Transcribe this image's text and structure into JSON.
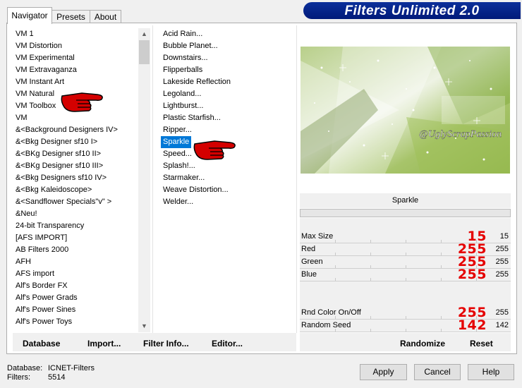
{
  "tabs": [
    "Navigator",
    "Presets",
    "About"
  ],
  "banner_title": "Filters Unlimited 2.0",
  "categories": [
    "VM 1",
    "VM Distortion",
    "VM Experimental",
    "VM Extravaganza",
    "VM Instant Art",
    "VM Natural",
    "VM Toolbox",
    "VM",
    "&<Background Designers IV>",
    "&<Bkg Designer sf10 I>",
    "&<BKg Designer sf10 II>",
    "&<BKg Designer sf10 III>",
    "&<Bkg Designers sf10 IV>",
    "&<Bkg Kaleidoscope>",
    "&<Sandflower Specials\"v\" >",
    "&Neu!",
    "24-bit Transparency",
    "[AFS IMPORT]",
    "AB Filters 2000",
    "AFH",
    "AFS import",
    "Alf's Border FX",
    "Alf's Power Grads",
    "Alf's Power Sines",
    "Alf's Power Toys"
  ],
  "filters": [
    "Acid Rain...",
    "Bubble Planet...",
    "Downstairs...",
    "Flipperballs",
    "Lakeside Reflection",
    "Legoland...",
    "Lightburst...",
    "Plastic Starfish...",
    "Ripper...",
    "Sparkle",
    "Speed...",
    "Splash!...",
    "Starmaker...",
    "Weave Distortion...",
    "Welder..."
  ],
  "selected_filter": "Sparkle",
  "watermark": "@UglyScrapPassion",
  "filter_title": "Sparkle",
  "params": [
    {
      "label": "Max Size",
      "annotation": "15",
      "value": "15"
    },
    {
      "label": "Red",
      "annotation": "255",
      "value": "255"
    },
    {
      "label": "Green",
      "annotation": "255",
      "value": "255"
    },
    {
      "label": "Blue",
      "annotation": "255",
      "value": "255"
    },
    {
      "label": "Rnd Color On/Off",
      "annotation": "255",
      "value": "255"
    },
    {
      "label": "Random Seed",
      "annotation": "142",
      "value": "142"
    }
  ],
  "bottom_buttons": {
    "database": "Database",
    "import": "Import...",
    "filter_info": "Filter Info...",
    "editor": "Editor..."
  },
  "randomize": "Randomize",
  "reset": "Reset",
  "status": {
    "database_label": "Database:",
    "database_value": "ICNET-Filters",
    "filters_label": "Filters:",
    "filters_value": "5514"
  },
  "dialog_buttons": {
    "apply": "Apply",
    "cancel": "Cancel",
    "help": "Help"
  },
  "colors": {
    "banner": "#0b2f9a",
    "selection": "#0078d7",
    "annotation": "#e50000",
    "pointer": "#d40000"
  }
}
